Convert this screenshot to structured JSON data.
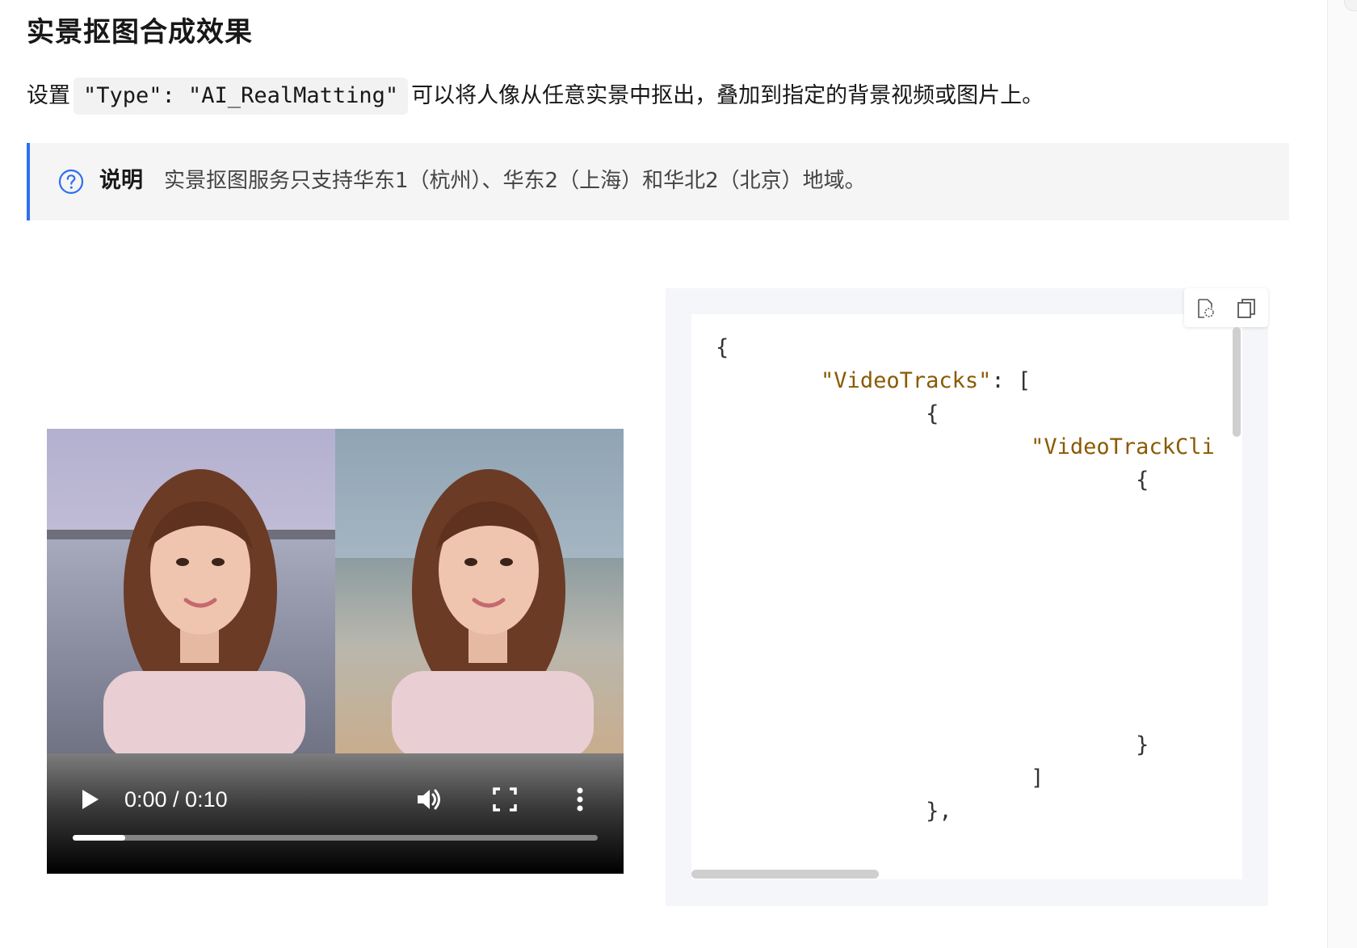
{
  "title": "实景抠图合成效果",
  "intro": {
    "before": "设置",
    "code": "\"Type\": \"AI_RealMatting\"",
    "after": "可以将人像从任意实景中抠出，叠加到指定的背景视频或图片上。"
  },
  "note": {
    "label": "说明",
    "text": "实景抠图服务只支持华东1（杭州）、华东2（上海）和华北2（北京）地域。",
    "icon": "question-circle-icon",
    "accent": "#2f6ff0"
  },
  "video": {
    "time": "0:00 / 0:10",
    "progress_fraction": 0.1
  },
  "code": {
    "lines": [
      {
        "indent": "",
        "key": "",
        "rest": "{"
      },
      {
        "indent": "        ",
        "key": "\"VideoTracks\"",
        "rest": ": ["
      },
      {
        "indent": "                ",
        "key": "",
        "rest": "{"
      },
      {
        "indent": "                        ",
        "key": "\"VideoTrackCli",
        "rest": ""
      },
      {
        "indent": "                                ",
        "key": "",
        "rest": "{"
      },
      {
        "indent": "                                ",
        "key": "",
        "rest": "}"
      },
      {
        "indent": "                        ",
        "key": "",
        "rest": "]"
      },
      {
        "indent": "                ",
        "key": "",
        "rest": "},"
      }
    ],
    "key_color": "#8a5a00"
  },
  "toolbar": {
    "icons": [
      "view-code-icon",
      "copy-icon"
    ]
  }
}
